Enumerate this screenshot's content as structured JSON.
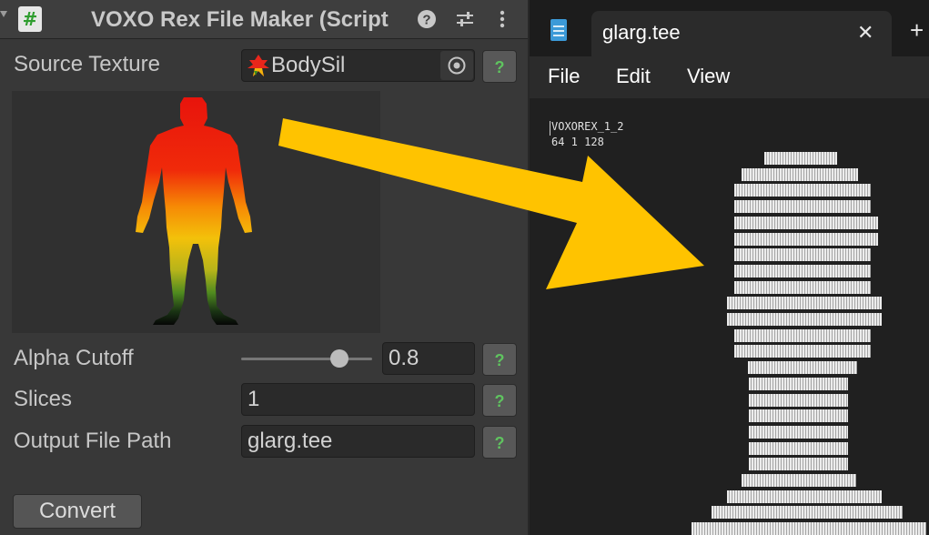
{
  "inspector": {
    "title": "VOXO Rex File Maker (Script",
    "component_icon": "#",
    "header_icons": [
      "help-icon",
      "sliders-icon",
      "kebab-menu-icon"
    ],
    "source_texture": {
      "label": "Source Texture",
      "value": "BodySil"
    },
    "alpha_cutoff": {
      "label": "Alpha Cutoff",
      "value": "0.8",
      "slider_fraction": 0.8
    },
    "slices": {
      "label": "Slices",
      "value": "1"
    },
    "output_path": {
      "label": "Output File Path",
      "value": "glarg.tee"
    },
    "help_label": "?",
    "convert_label": "Convert"
  },
  "notepad": {
    "tab_title": "glarg.tee",
    "close_glyph": "✕",
    "new_tab_glyph": "+",
    "menu": [
      "File",
      "Edit",
      "View"
    ],
    "lines": [
      "VOXOREX_1_2",
      "64 1 128"
    ]
  },
  "colors": {
    "arrow": "#ffc300",
    "help_check": "#5fc35f"
  }
}
